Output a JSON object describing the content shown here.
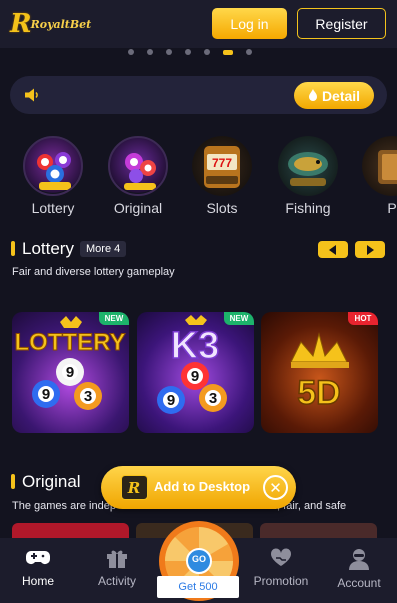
{
  "header": {
    "logo_text": "RoyaltBet",
    "login_label": "Log in",
    "register_label": "Register"
  },
  "carousel": {
    "dot_count": 7,
    "active_index": 5
  },
  "notice": {
    "speaker_icon": "speaker-icon",
    "detail_label": "Detail",
    "detail_icon": "flame-icon"
  },
  "categories": [
    {
      "label": "Lottery",
      "icon": "lottery-balls-icon"
    },
    {
      "label": "Original",
      "icon": "original-balls-icon"
    },
    {
      "label": "Slots",
      "icon": "slot-machine-icon"
    },
    {
      "label": "Fishing",
      "icon": "fishing-icon"
    },
    {
      "label": "P",
      "icon": "poker-icon"
    }
  ],
  "lottery_section": {
    "title": "Lottery",
    "more_label": "More 4",
    "subtitle": "Fair and diverse lottery gameplay",
    "games": [
      {
        "title": "LOTTERY",
        "badge": "NEW",
        "balls": [
          "9",
          "9",
          "3"
        ]
      },
      {
        "title": "K3",
        "badge": "NEW",
        "balls": [
          "9",
          "9",
          "3"
        ]
      },
      {
        "title": "5D",
        "badge": "HOT"
      }
    ]
  },
  "original_section": {
    "title": "Original",
    "subtitle_left": "The games are indep",
    "subtitle_right": "r, fair, and safe"
  },
  "add_to_desktop": {
    "label": "Add to Desktop",
    "close_icon": "close-icon"
  },
  "wheel": {
    "label": "GO",
    "promo": "Get 500"
  },
  "bottom_nav": [
    {
      "label": "Home",
      "icon": "gamepad-icon",
      "active": true
    },
    {
      "label": "Activity",
      "icon": "gift-icon",
      "active": false
    },
    {
      "label": "Promotion",
      "icon": "heart-hands-icon",
      "active": false
    },
    {
      "label": "Account",
      "icon": "user-icon",
      "active": false
    }
  ],
  "colors": {
    "accent": "#f5c21b",
    "background": "#13131f",
    "panel": "#1c1c2c",
    "hot": "#e8242f",
    "new": "#1db36b"
  }
}
